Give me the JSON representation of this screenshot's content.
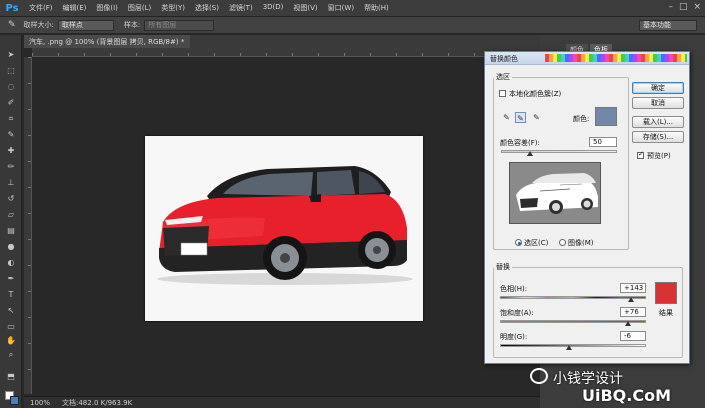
{
  "app": {
    "logo": "Ps"
  },
  "menu": [
    "文件(F)",
    "编辑(E)",
    "图像(I)",
    "图层(L)",
    "类型(Y)",
    "选择(S)",
    "滤镜(T)",
    "3D(D)",
    "视图(V)",
    "窗口(W)",
    "帮助(H)"
  ],
  "options_bar": {
    "sample_size_label": "取样大小:",
    "sample_size_value": "取样点",
    "sample_label": "样本:",
    "sample_value": "所有图层",
    "workspace": "基本功能"
  },
  "document": {
    "tab_title": "汽车, .png @ 100% (背景图层 拷贝, RGB/8#) *",
    "status_zoom": "100%",
    "status_doc": "文档:482.0 K/963.9K"
  },
  "panel_tabs": [
    "颜色",
    "色板"
  ],
  "dialog": {
    "title": "替换颜色",
    "selection_legend": "选区",
    "localized_clusters_label": "本地化颜色簇(Z)",
    "localized_clusters_checked": false,
    "color_label": "颜色:",
    "sample_color": "#7388a8",
    "fuzziness_label": "颜色容差(F):",
    "fuzziness_value": "50",
    "fuzziness": 50,
    "view_selection_label": "选区(C)",
    "view_image_label": "图像(M)",
    "view_mode": "selection",
    "replacement_legend": "替换",
    "hue_label": "色相(H):",
    "hue_value": "+143",
    "hue": 143,
    "saturation_label": "饱和度(A):",
    "saturation_value": "+76",
    "saturation": 76,
    "lightness_label": "明度(G):",
    "lightness_value": "-6",
    "lightness": -6,
    "result_label": "结果",
    "result_color": "#d93232",
    "buttons": {
      "ok": "确定",
      "cancel": "取消",
      "load": "载入(L)...",
      "save": "存储(S)..."
    },
    "preview_label": "预览(P)",
    "preview_checked": true
  },
  "watermark": {
    "text": "小钱学设计",
    "site": "UiBQ.CoM"
  },
  "colors": {
    "car_body": "#e8202c",
    "fg": "#ffffff",
    "bg": "#4a7fbe"
  }
}
